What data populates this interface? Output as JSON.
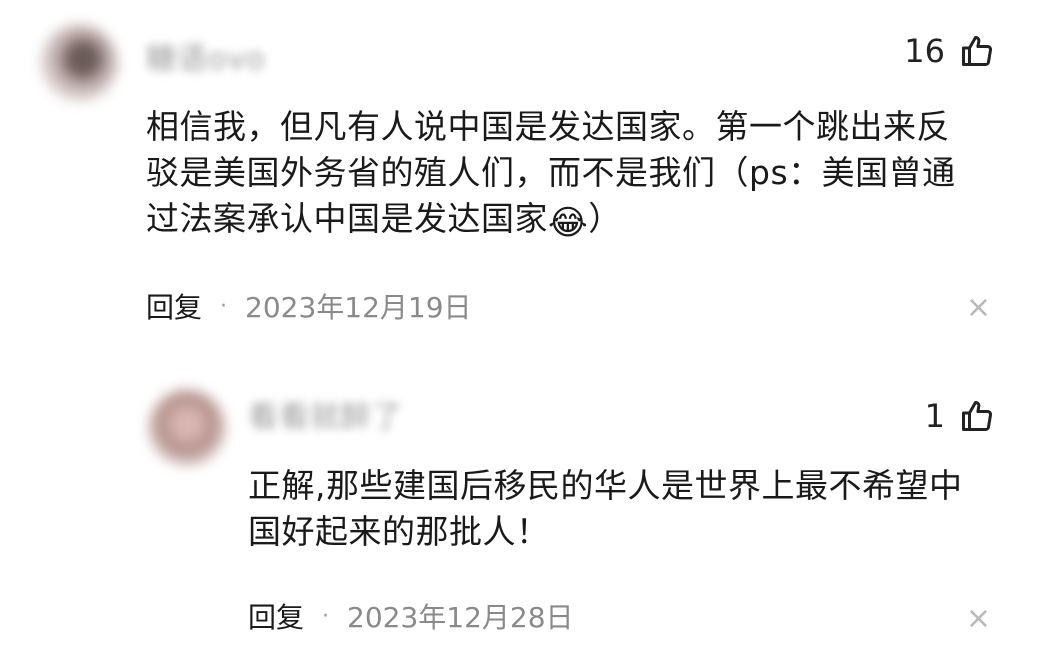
{
  "comments": [
    {
      "username": "糖语ovo",
      "like_count": "16",
      "text_line1": "相信我，但凡有人说中国是发达国家。第一个跳出来反",
      "text_line2": "驳是美国外务省的殖人们，而不是我们（ps：美国曾通",
      "text_line3": "过法案承认中国是发达国家",
      "emoji": "😂",
      "text_end": "）",
      "reply_label": "回复",
      "dot": "·",
      "date": "2023年12月19日",
      "close": "×",
      "icons": [
        "avatar",
        "thumb-up-icon",
        "close-icon"
      ]
    },
    {
      "username": "看看就醉了",
      "like_count": "1",
      "text_line1": "正解,那些建国后移民的华人是世界上最不希望中",
      "text_line2": "国好起来的那批人！",
      "reply_label": "回复",
      "dot": "·",
      "date": "2023年12月28日",
      "close": "×",
      "icons": [
        "avatar",
        "thumb-up-icon",
        "close-icon"
      ]
    }
  ]
}
